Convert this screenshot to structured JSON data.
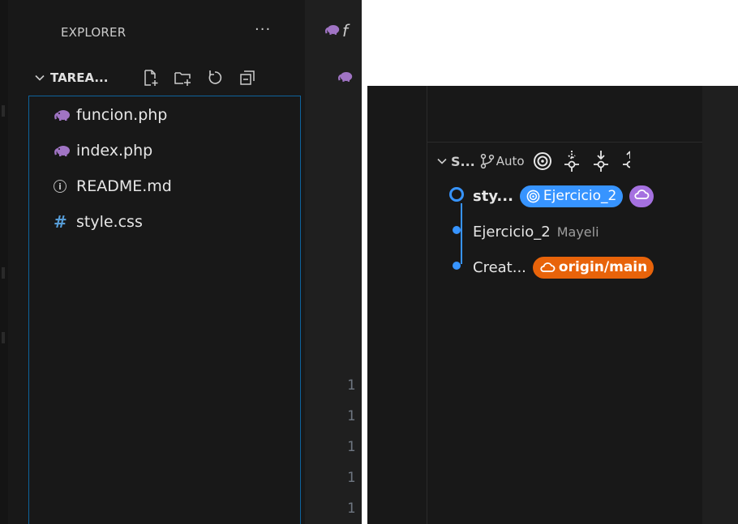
{
  "explorer": {
    "header": "EXPLORER",
    "more": "···",
    "folder_name": "TAREA...",
    "files": [
      {
        "name": "funcion.php",
        "icon": "php-elephant-icon"
      },
      {
        "name": "index.php",
        "icon": "php-elephant-icon"
      },
      {
        "name": "README.md",
        "icon": "info-icon"
      },
      {
        "name": "style.css",
        "icon": "hash-icon"
      }
    ]
  },
  "editor": {
    "tab_text": "f",
    "line_numbers": [
      "1",
      "1",
      "1",
      "1",
      "1"
    ]
  },
  "graph": {
    "title": "S...",
    "auto_label": "Auto",
    "commits": [
      {
        "message": "sty...",
        "badge": "Ejercicio_2"
      },
      {
        "message": "Ejercicio_2",
        "author": "Mayeli"
      },
      {
        "message": "Creat...",
        "badge": "origin/main"
      }
    ]
  },
  "colors": {
    "accent_blue": "#3794ff",
    "remote_orange": "#e8630a",
    "cloud_purple": "#a571e0",
    "php_purple": "#a074c4",
    "focus_border": "#0e639c"
  }
}
